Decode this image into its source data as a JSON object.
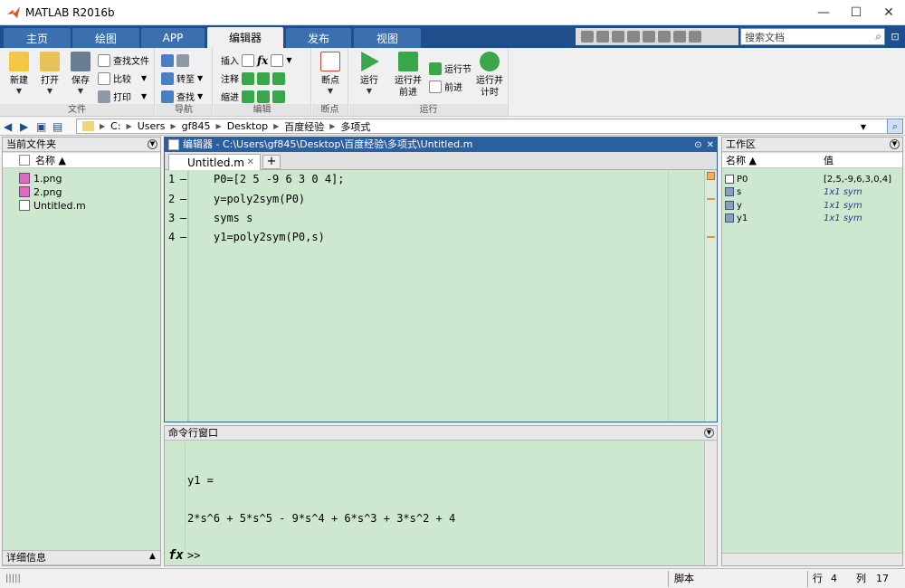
{
  "window": {
    "title": "MATLAB R2016b",
    "minimize": "—",
    "maximize": "☐",
    "close": "✕"
  },
  "tabs": [
    {
      "label": "主页"
    },
    {
      "label": "绘图"
    },
    {
      "label": "APP"
    },
    {
      "label": "编辑器",
      "active": true
    },
    {
      "label": "发布"
    },
    {
      "label": "视图"
    }
  ],
  "search": {
    "placeholder": "搜索文档"
  },
  "toolstrip": {
    "file": {
      "label": "文件",
      "new": "新建",
      "open": "打开",
      "save": "保存",
      "find_files": "查找文件",
      "compare": "比较",
      "print": "打印"
    },
    "nav": {
      "label": "导航",
      "goto": "转至",
      "find": "查找"
    },
    "edit": {
      "label": "编辑",
      "insert": "插入",
      "comment": "注释",
      "indent": "缩进",
      "fx": "fx"
    },
    "breakpoints": {
      "label": "断点",
      "breakpoints": "断点"
    },
    "run": {
      "label": "运行",
      "run": "运行",
      "run_advance_1": "运行并",
      "run_advance_2": "前进",
      "run_section": "运行节",
      "advance": "前进",
      "run_time_1": "运行并",
      "run_time_2": "计时"
    }
  },
  "path": {
    "segments": [
      "C:",
      "Users",
      "gf845",
      "Desktop",
      "百度经验",
      "多项式"
    ]
  },
  "current_folder": {
    "title": "当前文件夹",
    "column": "名称 ▲",
    "files": [
      {
        "name": "1.png",
        "type": "png"
      },
      {
        "name": "2.png",
        "type": "png"
      },
      {
        "name": "Untitled.m",
        "type": "m"
      }
    ],
    "details": "详细信息"
  },
  "editor": {
    "title": "编辑器 - C:\\Users\\gf845\\Desktop\\百度经验\\多项式\\Untitled.m",
    "tab": "Untitled.m",
    "lines": [
      {
        "num": "1",
        "code": "P0=[2 5 -9 6 3 0 4];"
      },
      {
        "num": "2",
        "code": "y=poly2sym(P0)"
      },
      {
        "num": "3",
        "code": "syms s"
      },
      {
        "num": "4",
        "code": "y1=poly2sym(P0,s)"
      }
    ]
  },
  "command_window": {
    "title": "命令行窗口",
    "output_var": "y1 =",
    "output_value": "2*s^6 + 5*s^5 - 9*s^4 + 6*s^3 + 3*s^2 + 4",
    "prompt": ">>",
    "fx": "fx"
  },
  "workspace": {
    "title": "工作区",
    "col_name": "名称 ▲",
    "col_value": "值",
    "vars": [
      {
        "name": "P0",
        "value": "[2,5,-9,6,3,0,4]",
        "kind": "matrix"
      },
      {
        "name": "s",
        "value": "1x1 sym",
        "kind": "sym"
      },
      {
        "name": "y",
        "value": "1x1 sym",
        "kind": "sym"
      },
      {
        "name": "y1",
        "value": "1x1 sym",
        "kind": "sym"
      }
    ]
  },
  "status": {
    "mode": "脚本",
    "row_label": "行",
    "row": "4",
    "col_label": "列",
    "col": "17"
  },
  "colors": {
    "accent": "#1e4e8c",
    "panel_bg": "#cde8cf",
    "editor_header": "#2c5fa0"
  }
}
